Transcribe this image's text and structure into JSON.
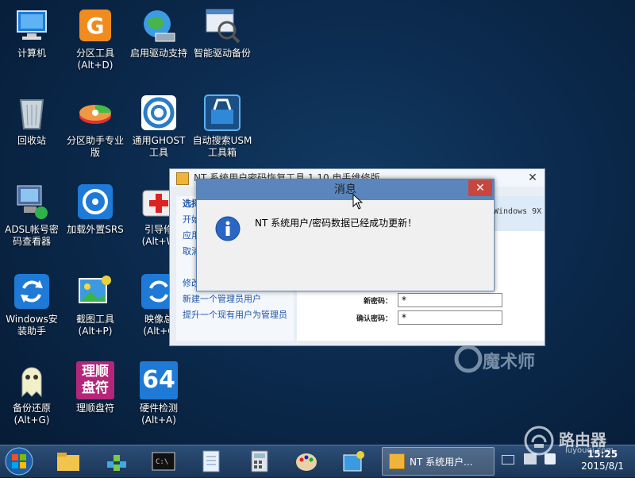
{
  "desktop": {
    "icons": [
      {
        "label": "计算机",
        "icon": "computer-icon"
      },
      {
        "label": "分区工具\n(Alt+D)",
        "icon": "diskgenius-icon"
      },
      {
        "label": "启用驱动支持",
        "icon": "globe-icon"
      },
      {
        "label": "智能驱动备份",
        "icon": "driver-backup-icon"
      },
      {
        "label": "回收站",
        "icon": "recycle-bin-icon"
      },
      {
        "label": "分区助手专业\n版",
        "icon": "partition-assistant-icon"
      },
      {
        "label": "通用GHOST\n工具",
        "icon": "ghost-icon"
      },
      {
        "label": "自动搜索USM\n工具箱",
        "icon": "toolbox-icon"
      },
      {
        "label": "ADSL帐号密\n码查看器",
        "icon": "adsl-icon"
      },
      {
        "label": "加载外置SRS",
        "icon": "srs-icon"
      },
      {
        "label": "引导修\n(Alt+W",
        "icon": "boot-repair-icon"
      },
      {
        "label": "Windows安\n装助手",
        "icon": "windows-install-icon"
      },
      {
        "label": "截图工具\n(Alt+P)",
        "icon": "screenshot-icon"
      },
      {
        "label": "映像总\n(Alt+C",
        "icon": "image-icon"
      },
      {
        "label": "备份还原\n(Alt+G)",
        "icon": "ghost-backup-icon"
      },
      {
        "label": "理顺盘符",
        "icon": "drive-letter-icon",
        "badge": "理顺\n盘符"
      },
      {
        "label": "硬件检测\n(Alt+A)",
        "icon": "hardware-icon",
        "badge": "64"
      }
    ]
  },
  "main_window": {
    "title": "NT 系统用户密码恢复工具 1.10 电手维修版",
    "left_items": [
      "选择",
      "开始",
      "应用",
      "取消",
      "",
      "修改现有用户的密码",
      "新建一个管理员用户",
      "提升一个现有用户为管理员"
    ],
    "right_header": "Windows 9X",
    "fields": [
      {
        "label": "新密码：",
        "value": "*"
      },
      {
        "label": "确认密码：",
        "value": "*"
      }
    ]
  },
  "dialog": {
    "title": "消息",
    "message": "NT 系统用户/密码数据已经成功更新！",
    "close_glyph": "✕"
  },
  "taskbar": {
    "active_task": "NT 系统用户...",
    "time": "15:25",
    "date": "2015/8/1"
  },
  "watermarks": {
    "magic": "魔术师",
    "router_title": "路由器",
    "router_url": "luyouqi.com"
  },
  "colors": {
    "dialog_title": "#5a86bd",
    "close_button": "#c7463e",
    "taskbar": "#1f3b61"
  }
}
